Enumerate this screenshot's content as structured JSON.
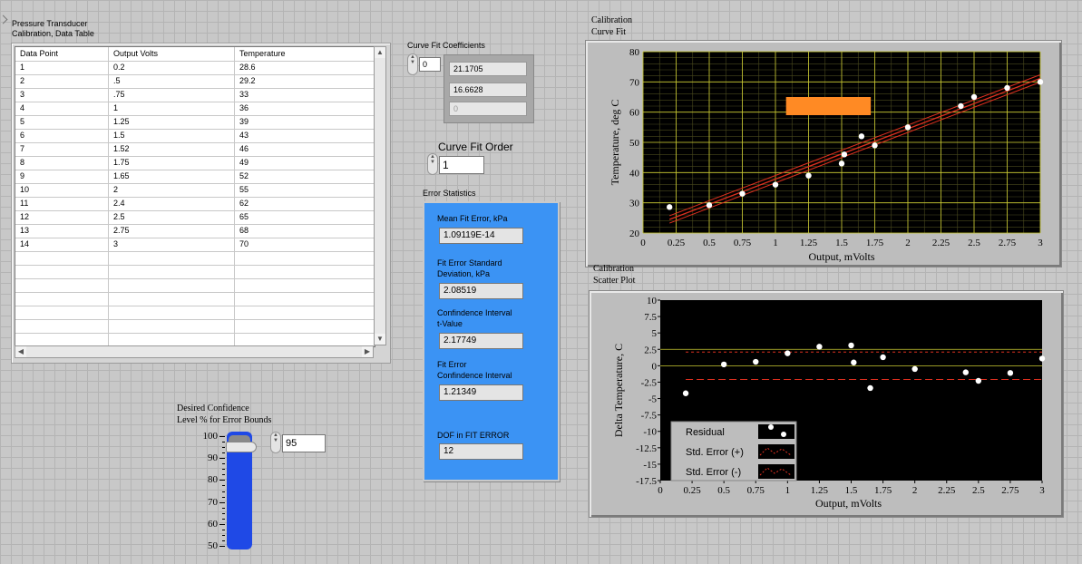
{
  "table": {
    "title_line1": "Pressure Transducer",
    "title_line2": "Calibration, Data Table",
    "columns": [
      "Data Point",
      "Output Volts",
      "Temperature"
    ],
    "rows": [
      [
        "1",
        "0.2",
        "28.6"
      ],
      [
        "2",
        ".5",
        "29.2"
      ],
      [
        "3",
        ".75",
        "33"
      ],
      [
        "4",
        "1",
        "36"
      ],
      [
        "5",
        "1.25",
        "39"
      ],
      [
        "6",
        "1.5",
        "43"
      ],
      [
        "7",
        "1.52",
        "46"
      ],
      [
        "8",
        "1.75",
        "49"
      ],
      [
        "9",
        "1.65",
        "52"
      ],
      [
        "10",
        "2",
        "55"
      ],
      [
        "11",
        "2.4",
        "62"
      ],
      [
        "12",
        "2.5",
        "65"
      ],
      [
        "13",
        "2.75",
        "68"
      ],
      [
        "14",
        "3",
        "70"
      ]
    ]
  },
  "coefficients": {
    "label": "Curve Fit Coefficients",
    "index": "0",
    "values": [
      "21.1705",
      "16.6628",
      "0"
    ]
  },
  "fit_order": {
    "label": "Curve Fit Order",
    "value": "1"
  },
  "error_stats": {
    "label": "Error Statistics",
    "mean_label": "Mean Fit Error, kPa",
    "mean_value": "1.09119E-14",
    "std_label_1": "Fit Error Standard",
    "std_label_2": "Deviation, kPa",
    "std_value": "2.08519",
    "tval_label_1": "Confindence Interval",
    "tval_label_2": "t-Value",
    "tval_value": "2.17749",
    "ci_label_1": "Fit Error",
    "ci_label_2": "Confindence Interval",
    "ci_value": "1.21349",
    "dof_label": "DOF in FIT ERROR",
    "dof_value": "12"
  },
  "confidence": {
    "label_line1": "Desired Confidence",
    "label_line2": "Level % for Error Bounds",
    "value": "95",
    "scale": [
      "100",
      "90",
      "80",
      "70",
      "60",
      "50"
    ],
    "level_fraction": 0.9
  },
  "colors": {
    "plot_bg": "#000000",
    "grid": "#cccc33",
    "fit_line": "#e03020",
    "point": "#ffffff",
    "marker": "#ff8a24",
    "stats_bg": "#3b93f4",
    "therm": "#1f49e6"
  },
  "chart_data": [
    {
      "type": "scatter",
      "title_line1": "Calibration",
      "title_line2": "Curve Fit",
      "xlabel": "Output, mVolts",
      "ylabel": "Temperature, deg C",
      "xlim": [
        0,
        3
      ],
      "ylim": [
        20,
        80
      ],
      "xticks": [
        "0",
        "0.25",
        "0.5",
        "0.75",
        "1",
        "1.25",
        "1.5",
        "1.75",
        "2",
        "2.25",
        "2.5",
        "2.75",
        "3"
      ],
      "yticks": [
        "20",
        "30",
        "40",
        "50",
        "60",
        "70",
        "80"
      ],
      "points": [
        [
          0.2,
          28.6
        ],
        [
          0.5,
          29.2
        ],
        [
          0.75,
          33
        ],
        [
          1,
          36
        ],
        [
          1.25,
          39
        ],
        [
          1.5,
          43
        ],
        [
          1.52,
          46
        ],
        [
          1.75,
          49
        ],
        [
          1.65,
          52
        ],
        [
          2,
          55
        ],
        [
          2.4,
          62
        ],
        [
          2.5,
          65
        ],
        [
          2.75,
          68
        ],
        [
          3,
          70
        ]
      ],
      "fit": {
        "intercept": 21.1705,
        "slope": 16.6628,
        "band": 1.21349
      }
    },
    {
      "type": "scatter",
      "title_line1": "Calibration",
      "title_line2": "Scatter Plot",
      "xlabel": "Output, mVolts",
      "ylabel": "Delta Temperature, C",
      "xlim": [
        0,
        3
      ],
      "ylim": [
        -17.5,
        10
      ],
      "xticks": [
        "0",
        "0.25",
        "0.5",
        "0.75",
        "1",
        "1.25",
        "1.5",
        "1.75",
        "2",
        "2.25",
        "2.5",
        "2.75",
        "3"
      ],
      "yticks": [
        "10",
        "7.5",
        "5",
        "2.5",
        "0",
        "-2.5",
        "-5",
        "-7.5",
        "-10",
        "-12.5",
        "-15",
        "-17.5"
      ],
      "residuals": [
        [
          0.2,
          -4.2
        ],
        [
          0.5,
          0.2
        ],
        [
          0.75,
          0.6
        ],
        [
          1,
          1.9
        ],
        [
          1.25,
          2.9
        ],
        [
          1.5,
          3.1
        ],
        [
          1.52,
          0.5
        ],
        [
          1.65,
          -3.4
        ],
        [
          1.75,
          1.3
        ],
        [
          2,
          -0.5
        ],
        [
          2.4,
          -1.0
        ],
        [
          2.5,
          -2.3
        ],
        [
          2.75,
          -1.1
        ],
        [
          3,
          1.1
        ]
      ],
      "std_error_bounds": [
        2.08519,
        -2.08519
      ],
      "legend": [
        "Residual",
        "Std. Error (+)",
        "Std. Error (-)"
      ]
    }
  ]
}
